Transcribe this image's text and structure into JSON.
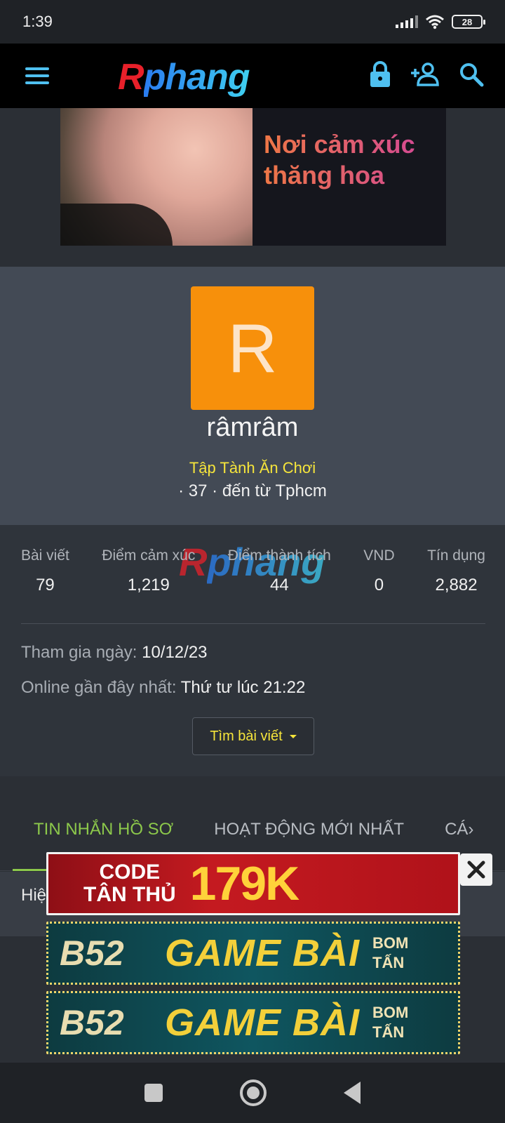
{
  "status_bar": {
    "time": "1:39",
    "battery": "28"
  },
  "header": {
    "logo_r": "R",
    "logo_rest": "phang",
    "icons": [
      "menu-icon",
      "lock-icon",
      "add-user-icon",
      "search-icon"
    ]
  },
  "top_banner": {
    "line1": "Nơi cảm xúc",
    "line2": "thăng hoa"
  },
  "profile": {
    "avatar_letter": "R",
    "username": "râmrâm",
    "title": "Tập Tành Ăn Chơi",
    "meta": "· 37 · đến từ Tphcm"
  },
  "stats": [
    {
      "label": "Bài viết",
      "value": "79"
    },
    {
      "label": "Điểm cảm xúc",
      "value": "1,219"
    },
    {
      "label": "Điểm thành tích",
      "value": "44"
    },
    {
      "label": "VND",
      "value": "0"
    },
    {
      "label": "Tín dụng",
      "value": "2,882"
    }
  ],
  "joined": {
    "label": "Tham gia ngày:",
    "value": "10/12/23"
  },
  "last_online": {
    "label": "Online gần đây nhất:",
    "value": "Thứ tư lúc 21:22"
  },
  "find_posts_label": "Tìm bài viết",
  "tabs": [
    {
      "label": "TIN NHẮN HỒ SƠ",
      "active": true
    },
    {
      "label": "HOẠT ĐỘNG MỚI NHẤT",
      "active": false
    },
    {
      "label": "CÁ›",
      "active": false
    }
  ],
  "tab_content_preview": "Hiệ",
  "ads": {
    "code": {
      "left_line1": "CODE",
      "left_line2": "TÂN THỦ",
      "amount": "179K"
    },
    "b52": {
      "logo": "B52",
      "main": "GAME BÀI",
      "side_line1": "BOM",
      "side_line2": "TẤN"
    }
  },
  "colors": {
    "accent_yellow": "#f6e53b",
    "accent_green": "#8cc84b",
    "avatar_orange": "#f7900b",
    "header_icon_blue": "#4fc0f0"
  }
}
